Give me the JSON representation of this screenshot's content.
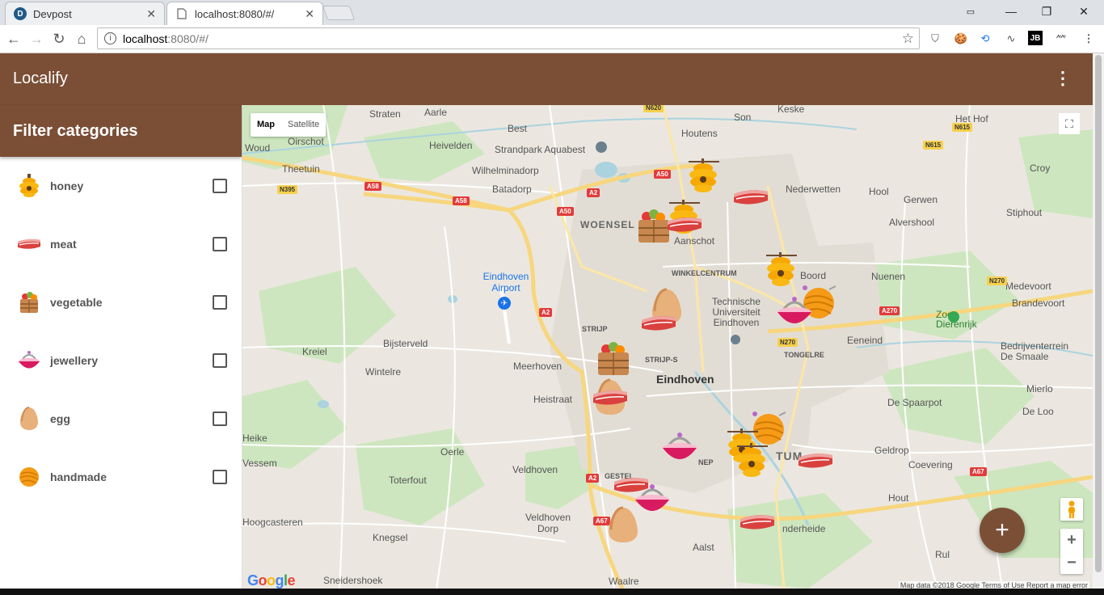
{
  "browser": {
    "tabs": [
      {
        "title": "Devpost",
        "favicon": "D",
        "color": "#1f5a88"
      },
      {
        "title": "localhost:8080/#/",
        "favicon": "page-icon",
        "color": "#888888"
      }
    ],
    "url_host": "localhost",
    "url_path": ":8080/#/"
  },
  "app": {
    "title": "Localify",
    "accent": "#7b4f36"
  },
  "sidebar": {
    "header": "Filter categories",
    "categories": [
      {
        "label": "honey",
        "icon": "honey-icon",
        "checked": false
      },
      {
        "label": "meat",
        "icon": "meat-icon",
        "checked": false
      },
      {
        "label": "vegetable",
        "icon": "vegetable-icon",
        "checked": false
      },
      {
        "label": "jewellery",
        "icon": "jewellery-icon",
        "checked": false
      },
      {
        "label": "egg",
        "icon": "egg-icon",
        "checked": false
      },
      {
        "label": "handmade",
        "icon": "handmade-icon",
        "checked": false
      }
    ]
  },
  "map": {
    "type_map": "Map",
    "type_satellite": "Satellite",
    "logo": "Google",
    "attribution": "Map data ©2018 Google  Terms of Use  Report a map error",
    "places": {
      "straten": "Straten",
      "aarle": "Aarle",
      "keske": "Keske",
      "best": "Best",
      "son": "Son",
      "houtens": "Houtens",
      "het_hof": "Het Hof",
      "woud": "Woud",
      "oirschot": "Oirschot",
      "heivelden": "Heivelden",
      "strandpark": "Strandpark Aquabest",
      "theetuin": "Theetuin",
      "wilhelminadorp": "Wilhelminadorp",
      "batadorp": "Batadorp",
      "croy": "Croy",
      "nederwetten": "Nederwetten",
      "hool": "Hool",
      "gerwen": "Gerwen",
      "stiphout": "Stiphout",
      "alvershool": "Alvershool",
      "woensel": "WOENSEL",
      "aanschot": "Aanschot",
      "winkelcentrum": "WINKELCENTRUM",
      "eindhoven_airport": "Eindhoven Airport",
      "nuenen": "Nuenen",
      "boord": "Boord",
      "medevoort": "Medevoort",
      "brandevoort": "Brandevoort",
      "tu": "Technische Universiteit Eindhoven",
      "zoo": "Zoo Dierenrijk",
      "strijp": "STRIJP",
      "kreiel": "Kreiel",
      "bijsterveld": "Bijsterveld",
      "eeneind": "Eeneind",
      "bedrijventerrein": "Bedrijventerrein De Smaale",
      "strijp_s": "STRIJP-S",
      "tongelre": "TONGELRE",
      "meerhoven": "Meerhoven",
      "wintelre": "Wintelre",
      "eindhoven": "Eindhoven",
      "mierlo": "Mierlo",
      "heistraat": "Heistraat",
      "de_spaarpot": "De Spaarpot",
      "de_loo": "De Loo",
      "heike": "Heike",
      "oerle": "Oerle",
      "vessem": "Vessem",
      "geldrop": "Geldrop",
      "coevering": "Coevering",
      "veldhoven": "Veldhoven",
      "toterfout": "Toterfout",
      "hout": "Hout",
      "veldhoven_dorp": "Veldhoven Dorp",
      "hoogcasteren": "Hoogcasteren",
      "knegsel": "Knegsel",
      "aalst": "Aalst",
      "rul": "Rul",
      "sneidershoek": "Sneidershoek",
      "waalre": "Waalre",
      "nderheide": "nderheide",
      "tum": "TUM",
      "gestel": "GESTEL",
      "nep": "NEP"
    },
    "roads": {
      "n620": "N620",
      "n615a": "N615",
      "n615b": "N615",
      "a50a": "A50",
      "a50b": "A50",
      "a58a": "A58",
      "a58b": "A58",
      "n395": "N395",
      "a2a": "A2",
      "a2b": "A2",
      "a2c": "A2",
      "n270a": "N270",
      "n270b": "N270",
      "a270": "A270",
      "a67a": "A67",
      "a67b": "A67"
    }
  }
}
